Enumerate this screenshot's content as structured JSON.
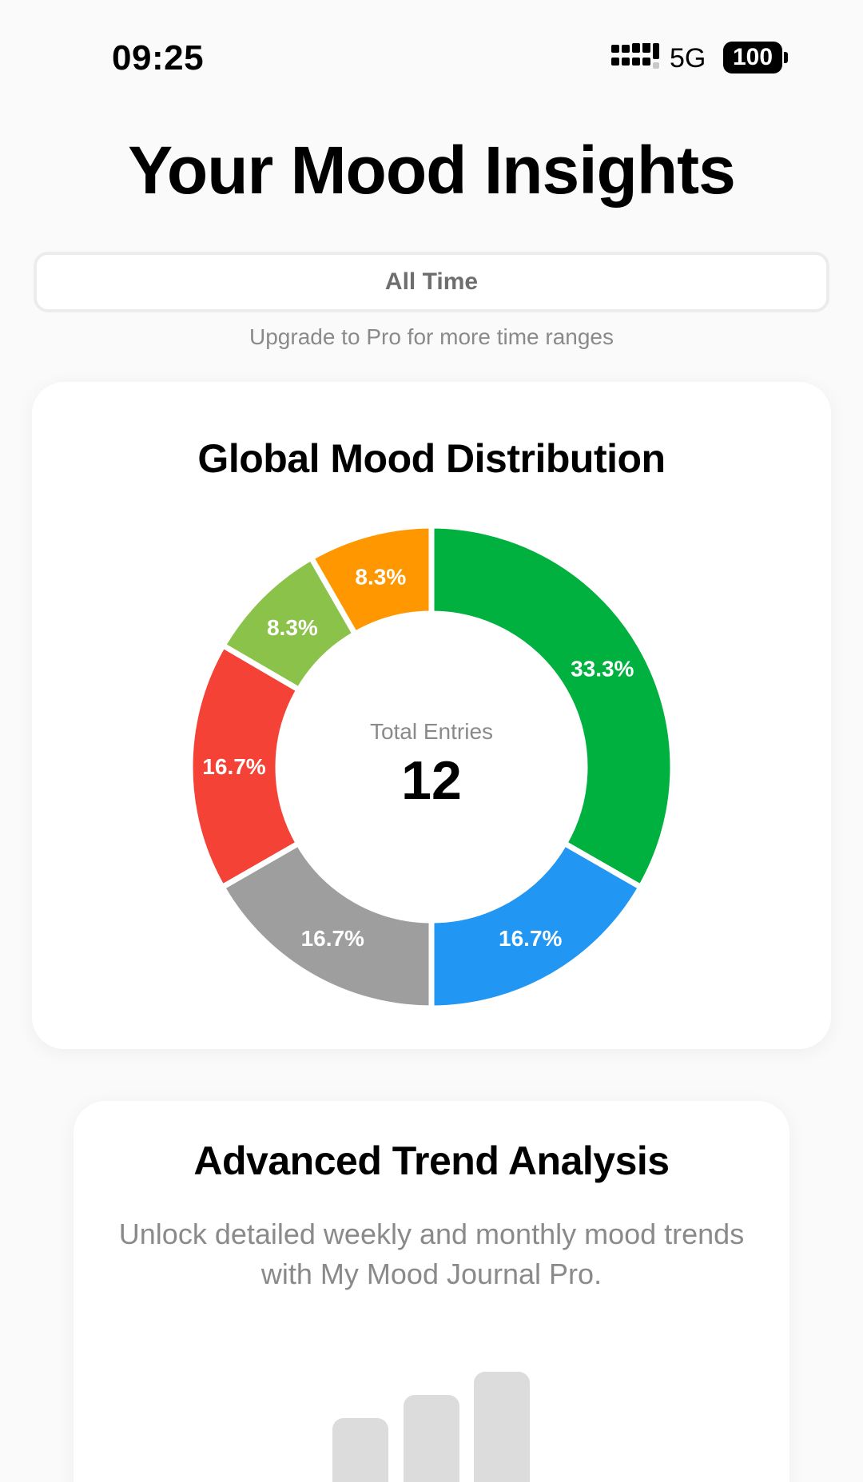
{
  "status_bar": {
    "time": "09:25",
    "network": "5G",
    "battery": "100",
    "icons": [
      "signal-icon",
      "battery-icon"
    ]
  },
  "header": {
    "title": "Your Mood Insights"
  },
  "range": {
    "selected": "All Time",
    "hint": "Upgrade to Pro for more time ranges"
  },
  "mood_card": {
    "title": "Global Mood Distribution",
    "center_label": "Total Entries",
    "center_value": "12"
  },
  "chart_data": {
    "type": "pie",
    "title": "Global Mood Distribution",
    "total": 12,
    "slices": [
      {
        "label": "33.3%",
        "value": 33.3,
        "color": "#00b140"
      },
      {
        "label": "16.7%",
        "value": 16.7,
        "color": "#2196f3"
      },
      {
        "label": "16.7%",
        "value": 16.7,
        "color": "#9e9e9e"
      },
      {
        "label": "16.7%",
        "value": 16.7,
        "color": "#f44336"
      },
      {
        "label": "8.3%",
        "value": 8.3,
        "color": "#8bc34a"
      },
      {
        "label": "8.3%",
        "value": 8.3,
        "color": "#ff9800"
      }
    ]
  },
  "trend_card": {
    "title": "Advanced Trend Analysis",
    "description": "Unlock detailed weekly and monthly mood trends with My Mood Journal Pro.",
    "bar_color": "#dcdcdc"
  }
}
